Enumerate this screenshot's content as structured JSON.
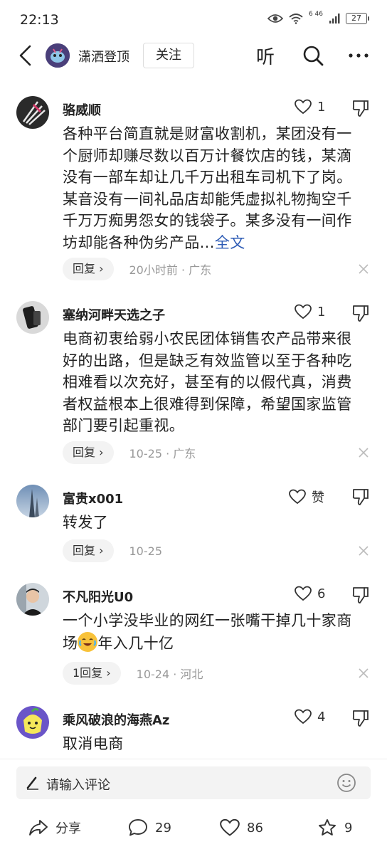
{
  "status_bar": {
    "time": "22:13",
    "network": "6 46",
    "battery": "27"
  },
  "nav": {
    "author_name": "潇洒登顶",
    "follow_label": "关注",
    "listen_label": "听"
  },
  "comments": [
    {
      "user": "骆威顺",
      "likes": "1",
      "text": "各种平台简直就是财富收割机，某团没有一个厨师却赚尽数以百万计餐饮店的钱，某滴没有一部车却让几千万出租车司机下了岗。某音没有一间礼品店却能凭虚拟礼物掏空千千万万痴男怨女的钱袋子。某多没有一间作坊却能各种伪劣产品...",
      "read_more": "全文",
      "reply_label": "回复 ›",
      "time_location": "20小时前 · 广东"
    },
    {
      "user": "塞纳河畔天选之子",
      "likes": "1",
      "text": "电商初衷给弱小农民团体销售农产品带来很好的出路，但是缺乏有效监管以至于各种吃相难看以次充好，甚至有的以假代真，消费者权益根本上很难得到保障，希望国家监管部门要引起重视。",
      "reply_label": "回复 ›",
      "time_location": "10-25 · 广东"
    },
    {
      "user": "富贵x001",
      "likes": "赞",
      "text": "转发了",
      "reply_label": "回复 ›",
      "time_location": "10-25"
    },
    {
      "user": "不凡阳光U0",
      "likes": "6",
      "text_before": "一个小学没毕业的网红一张嘴干掉几十家商场",
      "text_after": "年入几十亿",
      "reply_label": "1回复 ›",
      "time_location": "10-24 · 河北"
    },
    {
      "user": "乘风破浪的海燕Az",
      "likes": "4",
      "text": "取消电商"
    }
  ],
  "input": {
    "placeholder": "请输入评论"
  },
  "bottom_bar": {
    "share_label": "分享",
    "comment_count": "29",
    "like_count": "86",
    "favorite_count": "9"
  }
}
